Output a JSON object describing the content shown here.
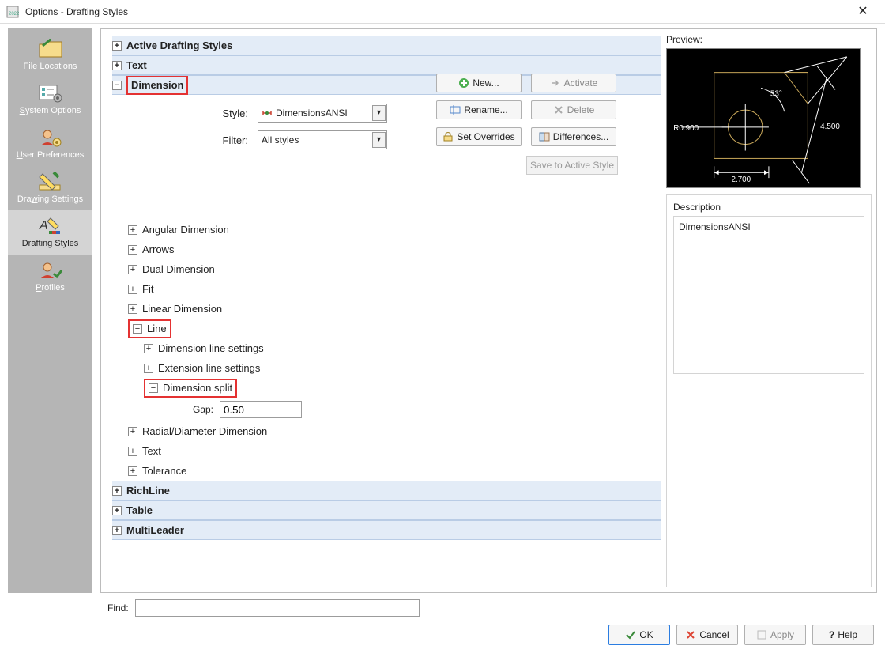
{
  "window": {
    "title": "Options - Drafting Styles"
  },
  "nav": {
    "items": [
      {
        "label": "File Locations",
        "underline": "F"
      },
      {
        "label": "System Options",
        "underline": "S"
      },
      {
        "label": "User Preferences",
        "underline": "U"
      },
      {
        "label": "Drawing Settings",
        "underline": "Dra"
      },
      {
        "label": "Drafting Styles",
        "underline": ""
      },
      {
        "label": "Profiles",
        "underline": "P"
      }
    ],
    "selected_index": 4
  },
  "tree": {
    "headers": {
      "active_drafting_styles": "Active Drafting Styles",
      "text": "Text",
      "dimension": "Dimension",
      "richline": "RichLine",
      "table": "Table",
      "multileader": "MultiLeader"
    },
    "dimension": {
      "style_label": "Style:",
      "style_value": "DimensionsANSI",
      "filter_label": "Filter:",
      "filter_value": "All styles",
      "children": [
        "Angular Dimension",
        "Arrows",
        "Dual Dimension",
        "Fit",
        "Linear Dimension",
        "Line",
        "Radial/Diameter Dimension",
        "Text",
        "Tolerance"
      ],
      "line": {
        "children": [
          "Dimension line settings",
          "Extension line settings",
          "Dimension split"
        ],
        "dimension_split": {
          "gap_label": "Gap:",
          "gap_value": "0.50"
        }
      }
    }
  },
  "actions": {
    "new": "New...",
    "rename": "Rename...",
    "set_overrides": "Set Overrides",
    "activate": "Activate",
    "delete": "Delete",
    "differences": "Differences...",
    "save_to_active": "Save to Active Style"
  },
  "preview": {
    "label": "Preview:",
    "dims": {
      "angle": "53°",
      "r": "R0.900",
      "len": "4.500",
      "w": "2.700"
    }
  },
  "description": {
    "label": "Description",
    "text": "DimensionsANSI"
  },
  "find": {
    "label": "Find:"
  },
  "footer": {
    "ok": "OK",
    "cancel": "Cancel",
    "apply": "Apply",
    "help": "Help"
  }
}
